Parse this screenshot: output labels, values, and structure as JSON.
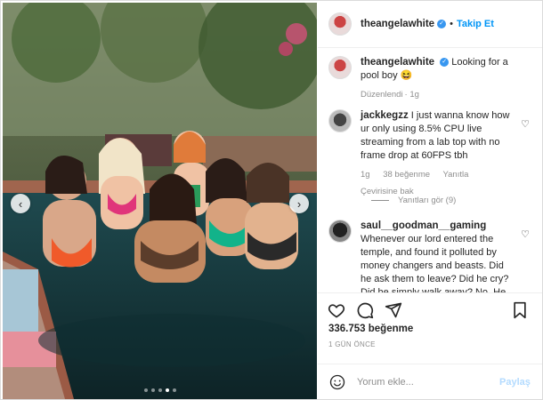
{
  "header": {
    "username": "theangelawhite",
    "verified_icon": "verified-badge-icon",
    "separator": "•",
    "follow_label": "Takip Et"
  },
  "caption": {
    "username": "theangelawhite",
    "text": "Looking for a pool boy",
    "emoji": "😆",
    "edited_label": "Düzenlendi",
    "time": "1g"
  },
  "comments": [
    {
      "username": "jackkegzz",
      "text": "I just wanna know how ur only using 8.5% CPU live streaming from a lab top with no frame drop at 60FPS tbh",
      "time": "1g",
      "likes": "38 beğenme",
      "reply_label": "Yanıtla",
      "translate_label": "Çevirisine bak",
      "view_replies_label": "Yanıtları gör (9)"
    },
    {
      "username": "saul__goodman__gaming",
      "text": "Whenever our lord entered the temple, and found it polluted by money changers and beasts. Did he ask them to leave? Did he cry? Did he simply walk away? No. He drove"
    }
  ],
  "actions": {
    "like_count": "336.753 beğenme",
    "time_ago": "1 GÜN ÖNCE"
  },
  "composer": {
    "placeholder": "Yorum ekle...",
    "share_label": "Paylaş"
  },
  "carousel": {
    "slide_count": 5,
    "active_index": 3
  },
  "colors": {
    "link_blue": "#0095f6",
    "verified_blue": "#3897f0",
    "muted_text": "#8e8e8e"
  }
}
